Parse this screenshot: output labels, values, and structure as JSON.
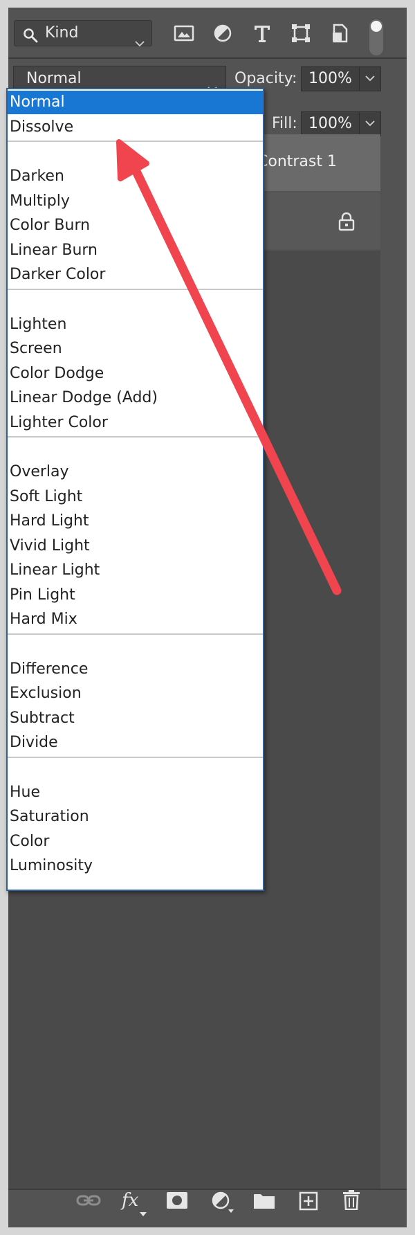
{
  "filter": {
    "search_label": "Kind",
    "icons": [
      "image-icon",
      "adjustment-circle-icon",
      "type-icon",
      "shape-transform-icon",
      "smart-object-icon"
    ]
  },
  "blend": {
    "current_mode": "Normal"
  },
  "opacity": {
    "label": "Opacity:",
    "value": "100%"
  },
  "fill": {
    "label": "Fill:",
    "value": "100%"
  },
  "layers": [
    {
      "name_visible_fragment": "Contrast 1"
    },
    {
      "locked": true
    }
  ],
  "blend_menu": {
    "selected": "Normal",
    "groups": [
      [
        "Normal",
        "Dissolve"
      ],
      [
        "Darken",
        "Multiply",
        "Color Burn",
        "Linear Burn",
        "Darker Color"
      ],
      [
        "Lighten",
        "Screen",
        "Color Dodge",
        "Linear Dodge (Add)",
        "Lighter Color"
      ],
      [
        "Overlay",
        "Soft Light",
        "Hard Light",
        "Vivid Light",
        "Linear Light",
        "Pin Light",
        "Hard Mix"
      ],
      [
        "Difference",
        "Exclusion",
        "Subtract",
        "Divide"
      ],
      [
        "Hue",
        "Saturation",
        "Color",
        "Luminosity"
      ]
    ]
  },
  "toolbar": {
    "icons": [
      "link-layers-icon",
      "fx-icon",
      "layer-mask-icon",
      "adjustment-layer-icon",
      "new-group-icon",
      "new-layer-icon",
      "delete-layer-icon"
    ],
    "fx_label": "fx"
  },
  "annotation": {
    "arrow_color": "#f0444e"
  },
  "colors": {
    "panel_bg": "#535353",
    "menu_highlight": "#1977d4",
    "menu_border": "#2e5f9e"
  }
}
